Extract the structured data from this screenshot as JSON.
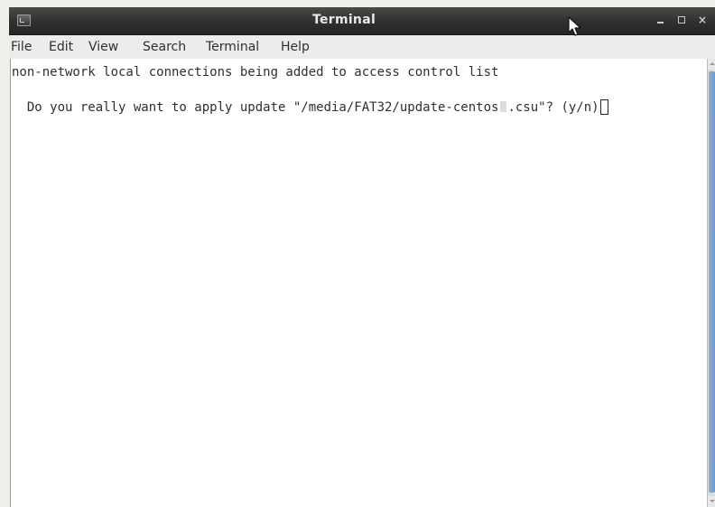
{
  "window": {
    "title": "Terminal",
    "close_glyph": "×"
  },
  "menu": {
    "items": [
      "File",
      "Edit",
      "View",
      "Search",
      "Terminal",
      "Help"
    ]
  },
  "terminal": {
    "line1": "non-network local connections being added to access control list",
    "line2_prefix": "  Do you really want to apply update \"/media/FAT32/update-centos",
    "line2_suffix": ".csu\"? (y/n)"
  },
  "colors": {
    "titlebar": "#2f2f2e",
    "terminal_bg": "#ffffff",
    "scroll_thumb": "#6f97c9"
  },
  "icons": [
    "window-menu-icon",
    "minimize-icon",
    "maximize-icon",
    "close-icon",
    "mouse-pointer-icon"
  ]
}
